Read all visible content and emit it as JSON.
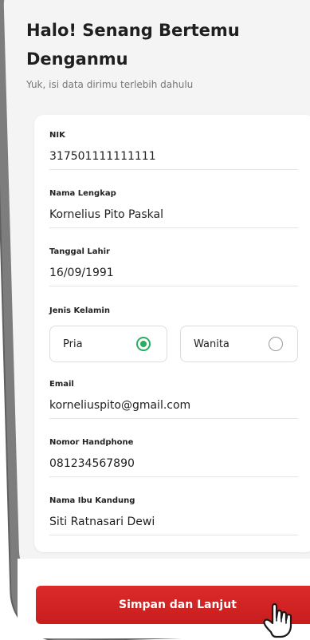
{
  "header": {
    "title": "Halo! Senang Bertemu Denganmu",
    "subtitle": "Yuk, isi data dirimu terlebih dahulu"
  },
  "form": {
    "nik": {
      "label": "NIK",
      "value": "317501111111111"
    },
    "full_name": {
      "label": "Nama Lengkap",
      "value": "Kornelius Pito Paskal"
    },
    "birth_date": {
      "label": "Tanggal Lahir",
      "value": "16/09/1991"
    },
    "gender": {
      "label": "Jenis Kelamin",
      "options": [
        {
          "label": "Pria",
          "selected": true
        },
        {
          "label": "Wanita",
          "selected": false
        }
      ]
    },
    "email": {
      "label": "Email",
      "value": "korneliuspito@gmail.com"
    },
    "phone": {
      "label": "Nomor Handphone",
      "value": "081234567890"
    },
    "mother_name": {
      "label": "Nama Ibu Kandung",
      "value": "Siti Ratnasari Dewi"
    }
  },
  "actions": {
    "submit_label": "Simpan dan Lanjut"
  },
  "icons": {
    "selected_radio": "radio-checked-icon",
    "unselected_radio": "radio-unchecked-icon",
    "pointer": "tap-hand-icon"
  },
  "colors": {
    "accent_red": "#d42424",
    "radio_green": "#27ae60",
    "background": "#f4f4f4"
  }
}
